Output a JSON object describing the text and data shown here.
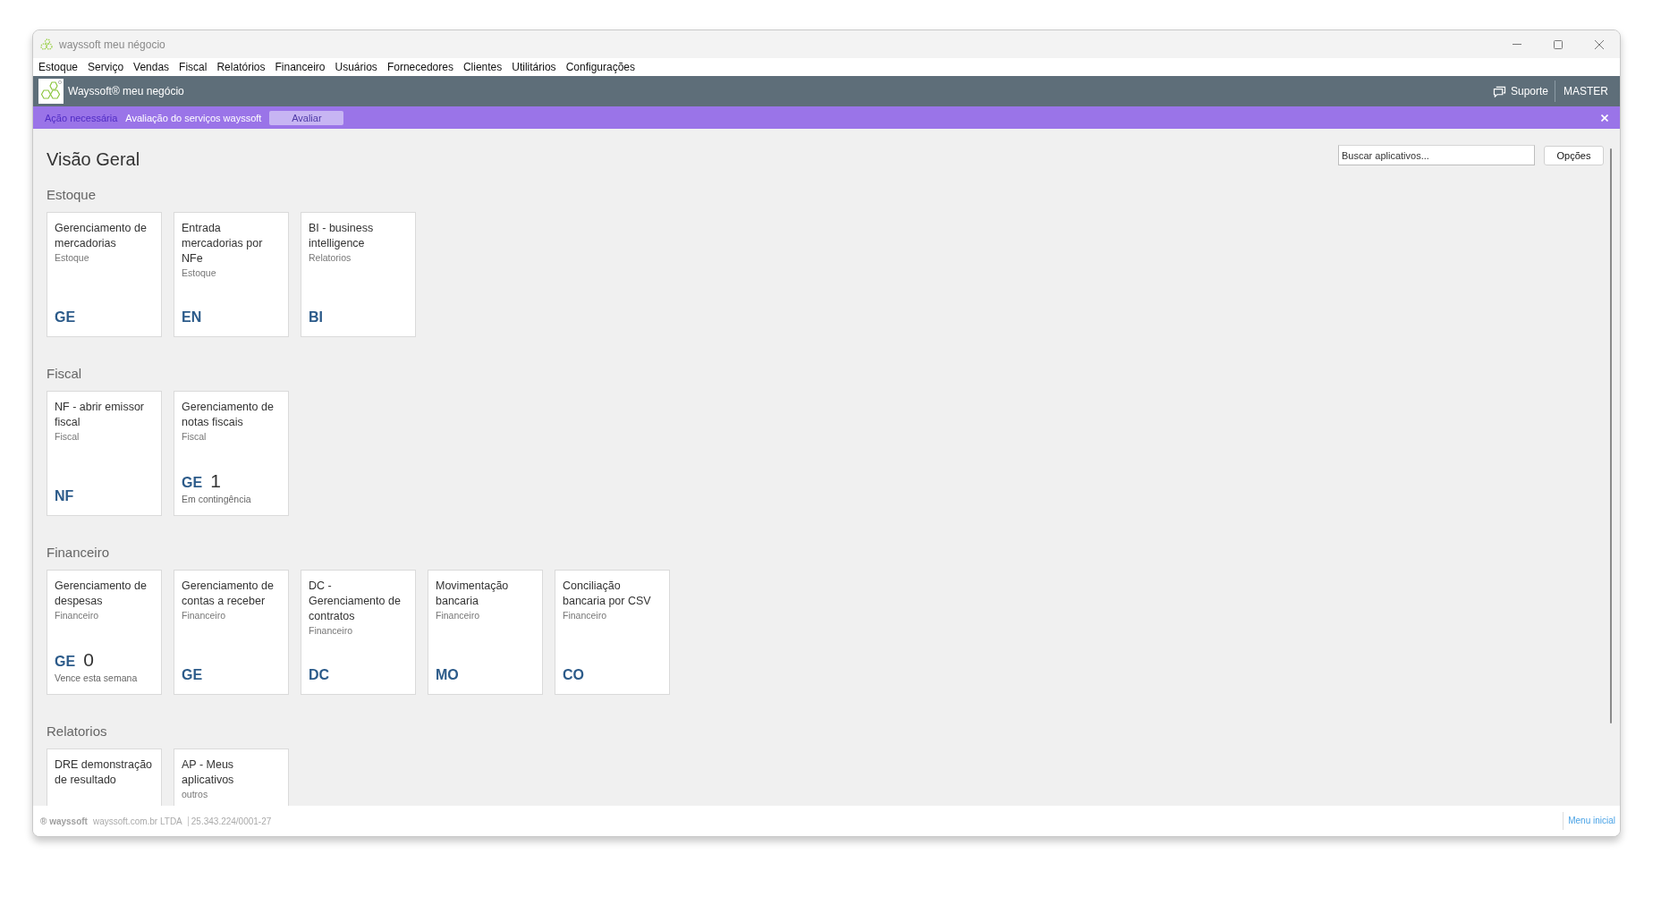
{
  "window": {
    "title": "wayssoft meu négocio"
  },
  "menu_bar": {
    "items": [
      "Estoque",
      "Serviço",
      "Vendas",
      "Fiscal",
      "Relatórios",
      "Financeiro",
      "Usuários",
      "Fornecedores",
      "Clientes",
      "Utilitários",
      "Configurações"
    ]
  },
  "header": {
    "brand": "Wayssoft® meu negócio",
    "support": "Suporte",
    "user": "MASTER"
  },
  "notice_bar": {
    "tag": "Ação necessária",
    "message": "Avaliação do serviços wayssoft",
    "button": "Avaliar"
  },
  "page": {
    "title": "Visão Geral",
    "search": {
      "placeholder": "Buscar aplicativos..."
    },
    "options_button": "Opções"
  },
  "sections": [
    {
      "title": "Estoque",
      "apps": [
        {
          "title": "Gerenciamento de mercadorias",
          "category": "Estoque",
          "code": "GE"
        },
        {
          "title": "Entrada mercadorias por NFe",
          "category": "Estoque",
          "code": "EN"
        },
        {
          "title": "BI - business intelligence",
          "category": "Relatorios",
          "code": "BI"
        }
      ]
    },
    {
      "title": "Fiscal",
      "apps": [
        {
          "title": "NF - abrir emissor fiscal",
          "category": "Fiscal",
          "code": "NF"
        },
        {
          "title": "Gerenciamento de notas fiscais",
          "category": "Fiscal",
          "code": "GE",
          "count": "1",
          "status": "Em contingência"
        }
      ]
    },
    {
      "title": "Financeiro",
      "apps": [
        {
          "title": "Gerenciamento de despesas",
          "category": "Financeiro",
          "code": "GE",
          "count": "0",
          "status": "Vence esta semana"
        },
        {
          "title": "Gerenciamento de contas a receber",
          "category": "Financeiro",
          "code": "GE"
        },
        {
          "title": "DC - Gerenciamento de contratos",
          "category": "Financeiro",
          "code": "DC"
        },
        {
          "title": "Movimentação bancaria",
          "category": "Financeiro",
          "code": "MO"
        },
        {
          "title": "Conciliação bancaria por CSV",
          "category": "Financeiro",
          "code": "CO"
        }
      ]
    },
    {
      "title": "Relatorios",
      "apps": [
        {
          "title": "DRE demonstração de resultado"
        },
        {
          "title": "AP - Meus aplicativos",
          "category": "outros"
        }
      ]
    }
  ],
  "footer": {
    "brand": "® wayssoft",
    "company": "wayssoft.com.br LTDA",
    "cnpj": "25.343.224/0001-27",
    "link": "Menu inicial"
  }
}
